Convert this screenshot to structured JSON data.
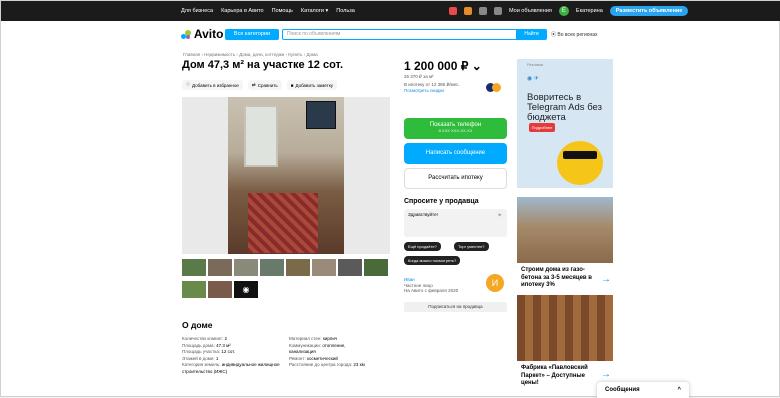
{
  "topbar": {
    "links": [
      "Для бизнеса",
      "Карьера в Авито",
      "Помощь",
      "Каталоги ▾",
      "Польза"
    ],
    "my_ads": "Мои объявления",
    "user": "Екатерина",
    "user_initial": "Е",
    "post_button": "Разместить объявление"
  },
  "header": {
    "logo": "Avito",
    "categories_button": "Все категории",
    "search_placeholder": "Поиск по объявлениям",
    "search_button": "Найти",
    "region": "Во всех регионах"
  },
  "breadcrumbs": "Главная › Недвижимость › Дома, дачи, коттеджи › Купить › Дома",
  "listing": {
    "title": "Дом 47,3 м² на участке 12 сот.",
    "actions": [
      "Добавить в избранное",
      "Сравнить",
      "Добавить заметку"
    ],
    "photo_more_icon": "camera-icon"
  },
  "about": {
    "heading": "О доме",
    "left": [
      {
        "label": "Количество комнат:",
        "value": "2"
      },
      {
        "label": "Площадь дома:",
        "value": "47.3 м²"
      },
      {
        "label": "Площадь участка:",
        "value": "12 сот."
      },
      {
        "label": "Этажей в доме:",
        "value": "1"
      },
      {
        "label": "Категория земель:",
        "value": "индивидуальное жилищное строительство (ИЖС)"
      }
    ],
    "right": [
      {
        "label": "Материал стен:",
        "value": "кирпич"
      },
      {
        "label": "Коммуникации:",
        "value": "отопление, канализация"
      },
      {
        "label": "Ремонт:",
        "value": "косметический"
      },
      {
        "label": "Расстояние до центра города:",
        "value": "23 км"
      }
    ]
  },
  "price": {
    "value": "1 200 000 ₽",
    "per_m2": "25 370 ₽ за м²",
    "mortgage": "В ипотеку от 12 385 ₽/мес.",
    "offers_link": "Посмотреть скидки"
  },
  "buttons": {
    "phone": "Показать телефон",
    "phone_sub": "8 XXX XXX-XX-XX",
    "message": "Написать сообщение",
    "mortgage": "Рассчитать ипотеку"
  },
  "ask": {
    "heading": "Спросите у продавца",
    "placeholder": "Здравствуйте!",
    "chips": [
      "Ещё продаёте?",
      "Торг уместен?",
      "Когда можно посмотреть?"
    ]
  },
  "seller": {
    "name": "Иван",
    "type": "Частное лицо",
    "since": "На Авито с февраля 2020",
    "initial": "И",
    "subscribe": "Подписаться на продавца"
  },
  "ads": {
    "ad1_label": "Реклама",
    "ad1_text": "Вовритесь в Telegram Ads без бюджета",
    "ad1_cta": "Подробнее",
    "ad2_title": "Строим дома из газо-бетона за 3-5 месяцев в ипотеку 3%",
    "ad3_title": "Фабрика «Павловский Паркет» – Доступные цены!"
  },
  "chat": {
    "label": "Сообщения",
    "chevron": "^"
  }
}
